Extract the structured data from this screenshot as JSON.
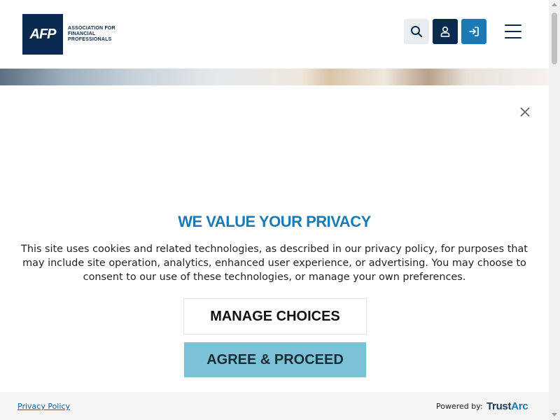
{
  "header": {
    "logo_mark": "AFP",
    "logo_text": [
      "ASSOCIATION FOR",
      "FINANCIAL",
      "PROFESSIONALS"
    ],
    "buttons": [
      {
        "icon": "search-icon"
      },
      {
        "icon": "user-icon"
      },
      {
        "icon": "login-icon"
      }
    ],
    "menu_icon": "hamburger-menu-icon"
  },
  "modal": {
    "close_icon": "close-icon",
    "title": "WE VALUE YOUR PRIVACY",
    "description": "This site uses cookies and related technologies, as described in our privacy policy, for purposes that may include site operation, analytics, enhanced user experience, or advertising. You may choose to consent to our use of these technologies, or manage your own preferences.",
    "manage_label": "MANAGE CHOICES",
    "agree_label": "AGREE & PROCEED"
  },
  "footer": {
    "privacy_link": "Privacy Policy",
    "powered_by": "Powered by:",
    "brand_trust": "Trust",
    "brand_arc": "Arc"
  },
  "colors": {
    "brand_navy": "#0b2a4f",
    "accent_blue": "#1a7ab5",
    "agree_button": "#7ac3d6"
  }
}
